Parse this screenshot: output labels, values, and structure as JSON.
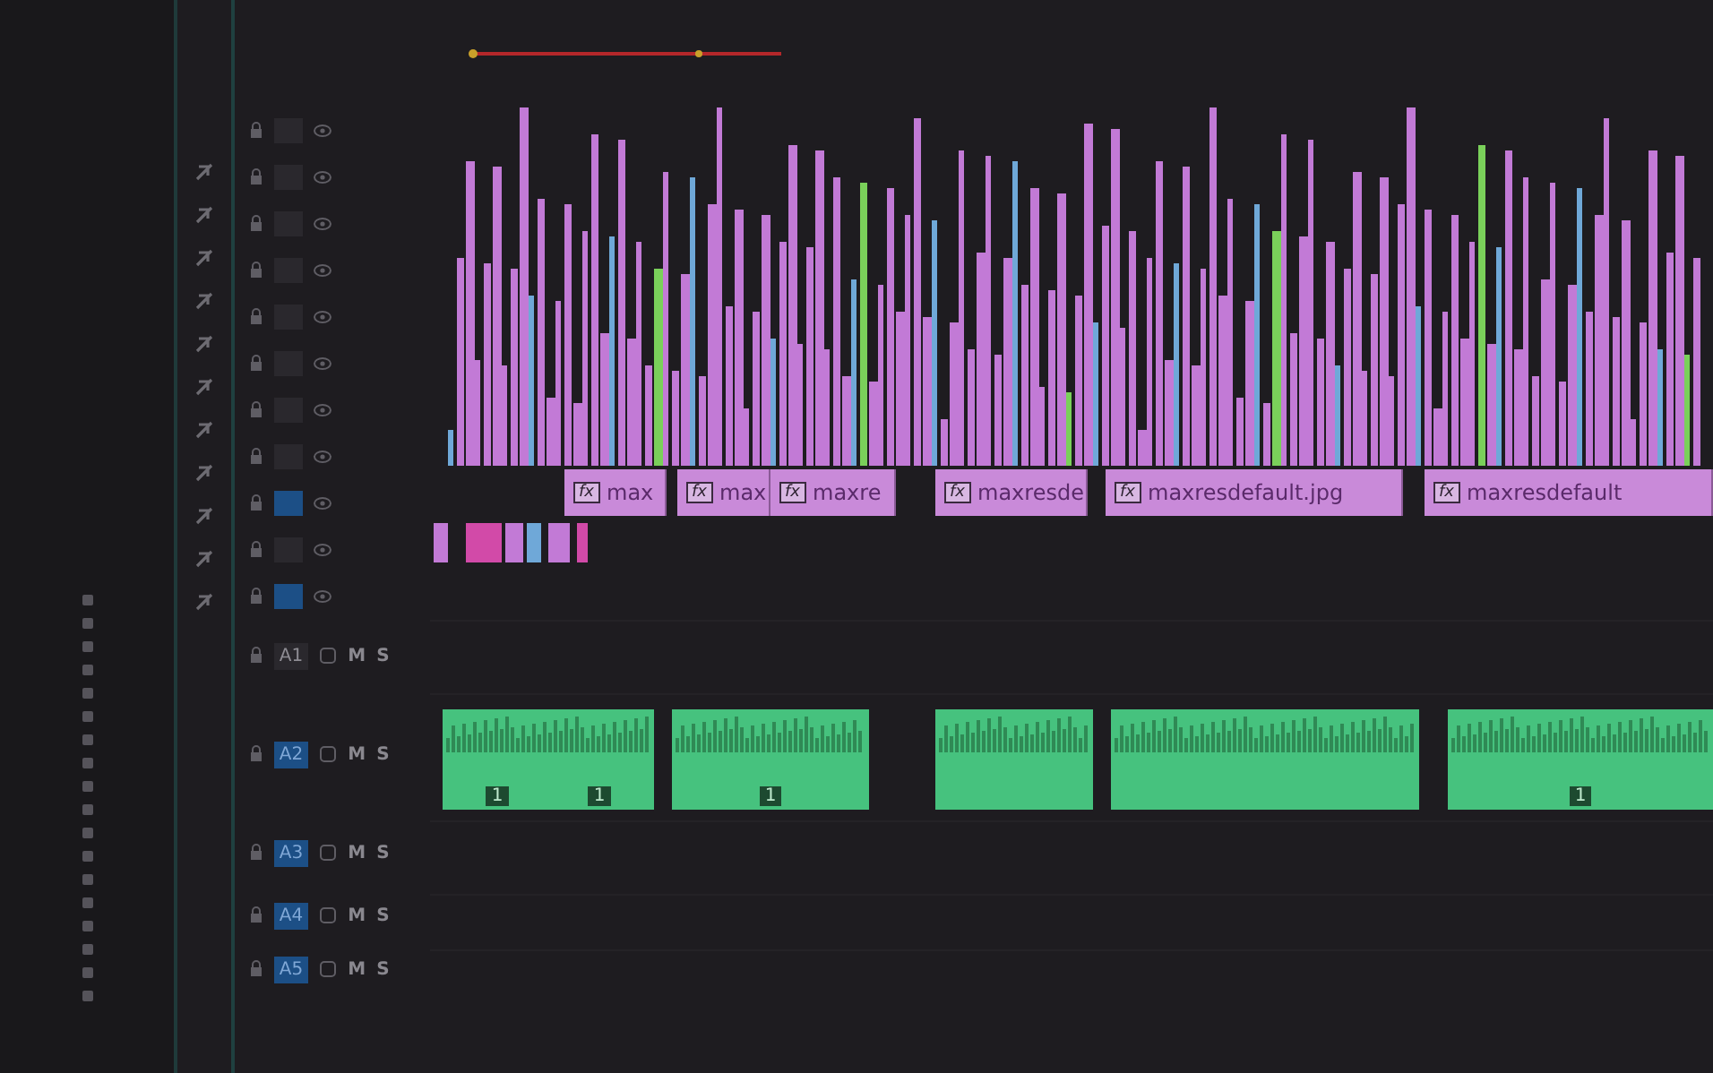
{
  "video_tracks": [
    {
      "selected": false
    },
    {
      "selected": false
    },
    {
      "selected": false
    },
    {
      "selected": false
    },
    {
      "selected": false
    },
    {
      "selected": false
    },
    {
      "selected": false
    },
    {
      "selected": false
    },
    {
      "selected": true
    },
    {
      "selected": false
    },
    {
      "selected": true
    }
  ],
  "video_clips": [
    {
      "badge": "fx",
      "label": "max"
    },
    {
      "badge": "fx",
      "label": "max"
    },
    {
      "badge": "fx",
      "label": "maxre"
    },
    {
      "badge": "fx",
      "label": "maxresde"
    },
    {
      "badge": "fx",
      "label": "maxresdefault.jpg"
    },
    {
      "badge": "fx",
      "label": "maxresdefault"
    }
  ],
  "audio_tracks": [
    {
      "name": "A1",
      "selected": false,
      "mute": "M",
      "solo": "S"
    },
    {
      "name": "A2",
      "selected": true,
      "mute": "M",
      "solo": "S"
    },
    {
      "name": "A3",
      "selected": true,
      "mute": "M",
      "solo": "S"
    },
    {
      "name": "A4",
      "selected": true,
      "mute": "M",
      "solo": "S"
    },
    {
      "name": "A5",
      "selected": true,
      "mute": "M",
      "solo": "S"
    }
  ],
  "audio_clips": [
    {
      "kind": "audio",
      "badges": [
        "1",
        "1"
      ]
    },
    {
      "kind": "audio",
      "badges": [
        "1"
      ]
    },
    {
      "kind": "audio"
    },
    {
      "kind": "audio"
    },
    {
      "kind": "audio",
      "badges": [
        "1"
      ]
    }
  ]
}
